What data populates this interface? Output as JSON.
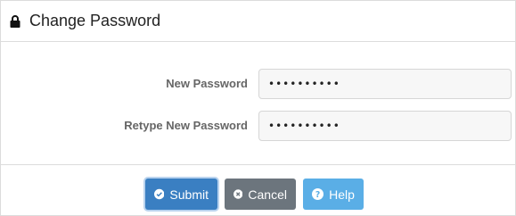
{
  "panel": {
    "title": "Change Password",
    "icon": "lock-icon"
  },
  "form": {
    "fields": [
      {
        "label": "New Password",
        "value": "••••••••••"
      },
      {
        "label": "Retype New Password",
        "value": "••••••••••"
      }
    ]
  },
  "actions": {
    "submit_label": "Submit",
    "cancel_label": "Cancel",
    "help_label": "Help"
  },
  "colors": {
    "submit": "#3a7fc2",
    "cancel": "#6c757d",
    "help": "#5aaee6"
  }
}
